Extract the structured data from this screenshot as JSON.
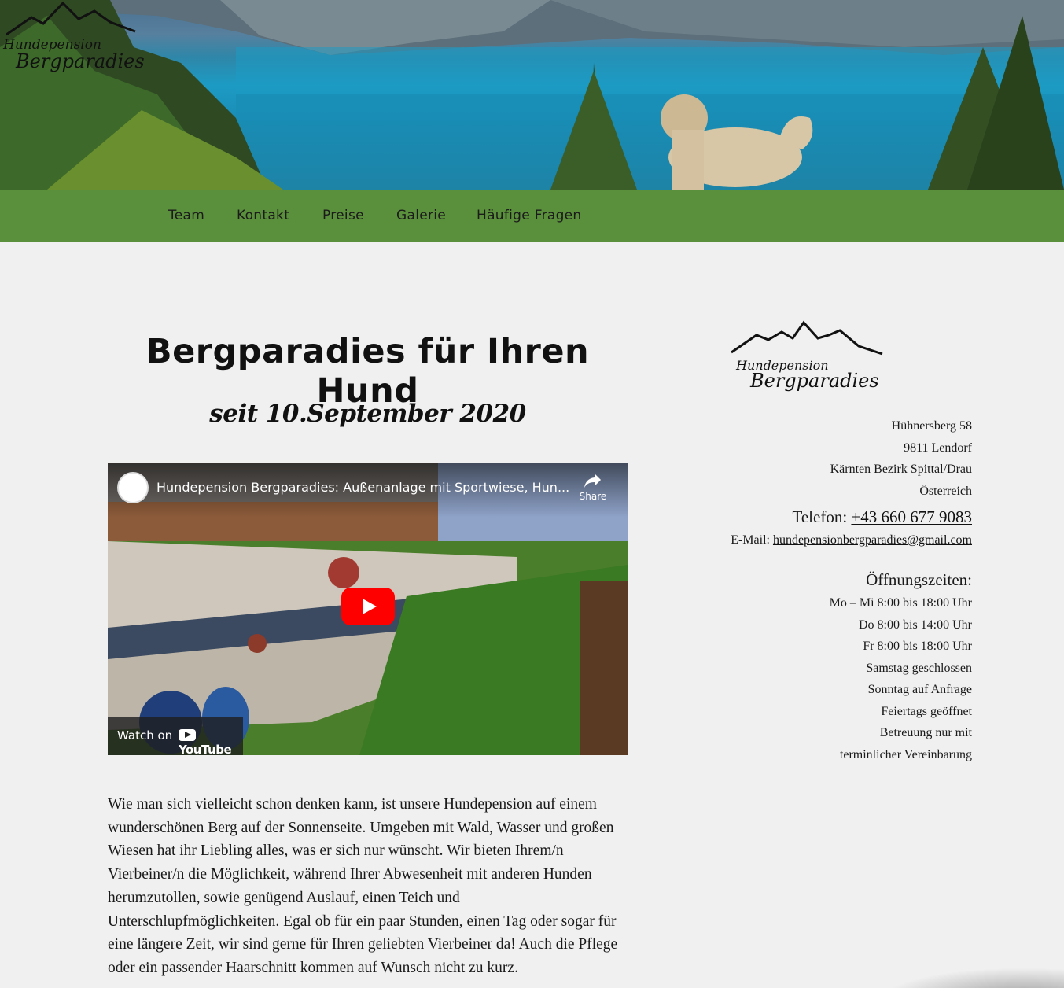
{
  "brand": {
    "logo_line1": "Hundepension",
    "logo_line2": "Bergparadies"
  },
  "nav": {
    "items": [
      {
        "label": "Team"
      },
      {
        "label": "Kontakt"
      },
      {
        "label": "Preise"
      },
      {
        "label": "Galerie"
      },
      {
        "label": "Häufige Fragen"
      }
    ]
  },
  "main": {
    "title": "Bergparadies für Ihren Hund",
    "subtitle": "seit 10.September 2020",
    "video": {
      "title": "Hundepension Bergparadies: Außenanlage mit Sportwiese, Hun...",
      "share_label": "Share",
      "watch_on": "Watch on",
      "youtube": "YouTube"
    },
    "paragraph": "Wie man sich vielleicht schon denken kann, ist unsere Hundepension auf einem wunderschönen Berg auf der Sonnenseite. Umgeben mit Wald, Wasser und großen Wiesen hat ihr Liebling alles, was er sich nur wünscht. Wir bieten Ihrem/n Vierbeiner/n die Möglichkeit, während Ihrer Abwesenheit mit anderen Hunden herumzutollen, sowie genügend Auslauf, einen Teich und Unterschlupfmöglichkeiten. Egal ob für ein paar Stunden, einen Tag oder sogar für eine längere Zeit, wir sind gerne für Ihren geliebten Vierbeiner da! Auch die Pflege oder ein passender Haarschnitt kommen auf Wunsch nicht zu kurz."
  },
  "sidebar": {
    "address": [
      "Hühnersberg 58",
      "9811 Lendorf",
      "Kärnten Bezirk Spittal/Drau",
      "Österreich"
    ],
    "phone_label": "Telefon:",
    "phone": "+43 660 677 9083",
    "email_label": "E-Mail:",
    "email": "hundepensionbergparadies@gmail.com",
    "hours_title": "Öffnungszeiten:",
    "hours": [
      "Mo – Mi 8:00 bis 18:00 Uhr",
      "Do 8:00 bis 14:00 Uhr",
      "Fr 8:00 bis 18:00 Uhr",
      "Samstag geschlossen",
      "Sonntag auf Anfrage",
      "Feiertags geöffnet",
      "Betreuung nur mit",
      "terminlicher Vereinbarung"
    ]
  },
  "colors": {
    "nav_bg": "#5a8f3c",
    "page_bg": "#f0f0f0",
    "youtube_red": "#ff0000"
  }
}
